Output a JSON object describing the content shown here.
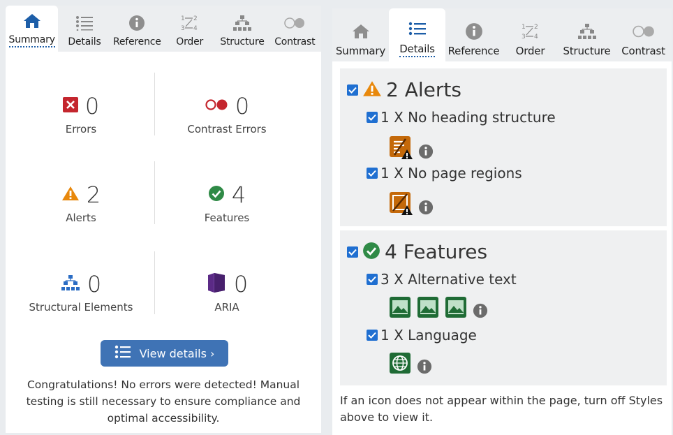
{
  "tabs": [
    {
      "label": "Summary",
      "icon": "home-icon"
    },
    {
      "label": "Details",
      "icon": "list-icon"
    },
    {
      "label": "Reference",
      "icon": "info-icon"
    },
    {
      "label": "Order",
      "icon": "order-icon"
    },
    {
      "label": "Structure",
      "icon": "structure-icon"
    },
    {
      "label": "Contrast",
      "icon": "contrast-icon"
    }
  ],
  "summary": {
    "errors": {
      "count": "0",
      "label": "Errors"
    },
    "contrast_errors": {
      "count": "0",
      "label": "Contrast Errors"
    },
    "alerts": {
      "count": "2",
      "label": "Alerts"
    },
    "features": {
      "count": "4",
      "label": "Features"
    },
    "structural": {
      "count": "0",
      "label": "Structural Elements"
    },
    "aria": {
      "count": "0",
      "label": "ARIA"
    },
    "view_details": "View details ›",
    "congrats": "Congratulations! No errors were detected! Manual testing is still necessary to ensure compliance and optimal accessibility."
  },
  "details": {
    "alerts": {
      "title": "2 Alerts",
      "items": [
        {
          "label": "1 X No heading structure",
          "icon_count": 1
        },
        {
          "label": "1 X No page regions",
          "icon_count": 1
        }
      ]
    },
    "features": {
      "title": "4 Features",
      "items": [
        {
          "label": "3 X Alternative text",
          "icon_count": 3
        },
        {
          "label": "1 X Language",
          "icon_count": 1
        }
      ]
    },
    "note": "If an icon does not appear within the page, turn off Styles above to view it."
  },
  "colors": {
    "accent": "#3f73b5",
    "error": "#c4262e",
    "alert": "#e8880c",
    "feature": "#2f8a46",
    "aria": "#5b2a86",
    "checkbox": "#1f6fd1"
  }
}
